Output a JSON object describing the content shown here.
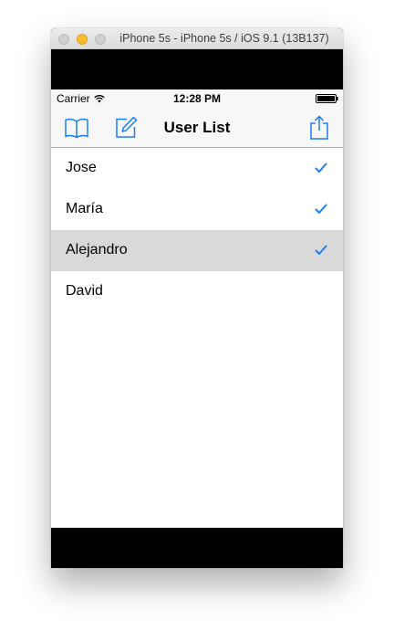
{
  "window": {
    "title": "iPhone 5s - iPhone 5s / iOS 9.1 (13B137)"
  },
  "status_bar": {
    "carrier": "Carrier",
    "time": "12:28 PM"
  },
  "nav_bar": {
    "title": "User List",
    "left_icons": [
      "book-icon",
      "compose-icon"
    ],
    "right_icon": "share-icon"
  },
  "users": [
    {
      "name": "Jose",
      "checked": true,
      "selected": false
    },
    {
      "name": "María",
      "checked": true,
      "selected": false
    },
    {
      "name": "Alejandro",
      "checked": true,
      "selected": true
    },
    {
      "name": "David",
      "checked": false,
      "selected": false
    }
  ],
  "colors": {
    "tint": "#1a7ef5",
    "selected_row": "#d9d9d9",
    "bar_background": "#f7f7f7"
  }
}
